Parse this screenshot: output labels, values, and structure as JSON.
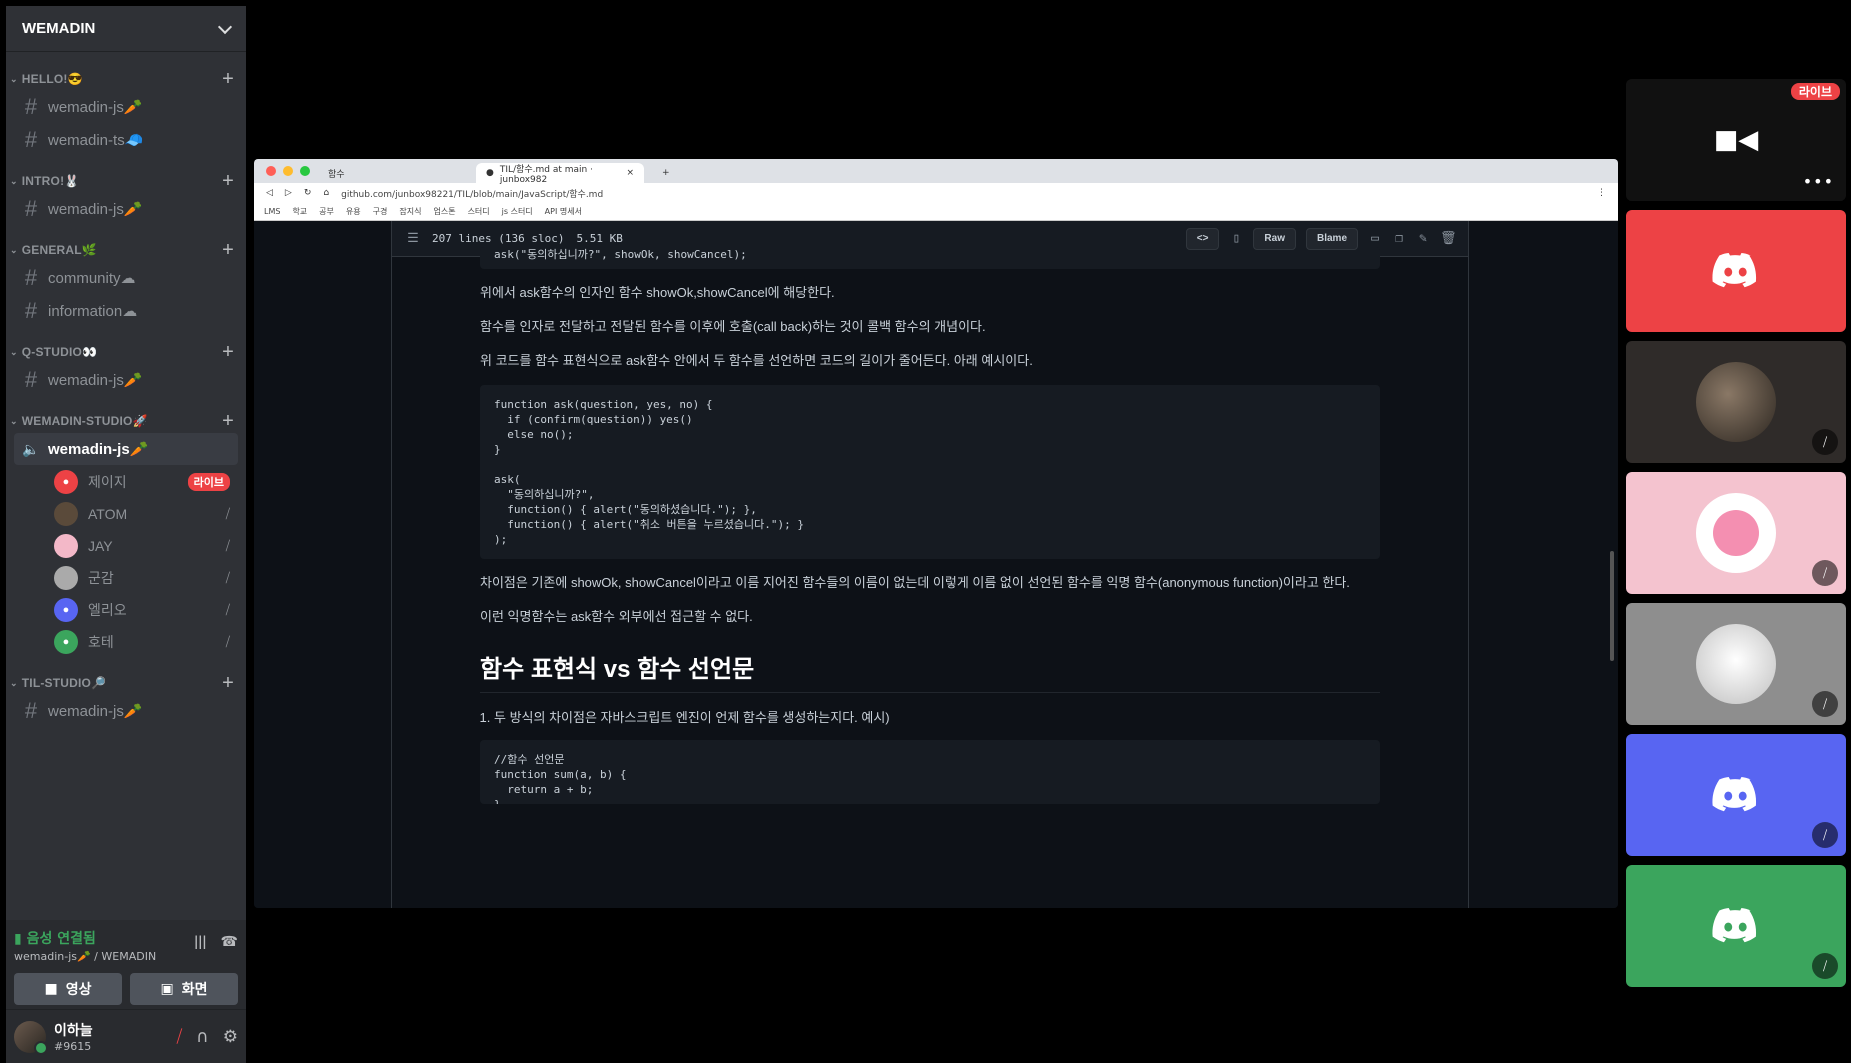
{
  "server": {
    "name": "WEMADIN"
  },
  "categories": [
    {
      "name": "HELLO!😎",
      "channels": [
        "wemadin-js🥕",
        "wemadin-ts🧢"
      ]
    },
    {
      "name": "INTRO!🐰",
      "channels": [
        "wemadin-js🥕"
      ]
    },
    {
      "name": "GENERAL🌿",
      "channels": [
        "community☁",
        "information☁"
      ]
    },
    {
      "name": "Q-STUDIO👀",
      "channels": [
        "wemadin-js🥕"
      ]
    },
    {
      "name": "WEMADIN-STUDIO🚀",
      "voice_channel": "wemadin-js🥕"
    },
    {
      "name": "TIL-STUDIO🔎",
      "channels": [
        "wemadin-js🥕"
      ]
    }
  ],
  "voice_users": [
    {
      "name": "제이지",
      "badge": "라이브",
      "color": "#ed4245"
    },
    {
      "name": "ATOM",
      "color": "#5a4a3a"
    },
    {
      "name": "JAY",
      "color": "#f3b8c8"
    },
    {
      "name": "군감",
      "color": "#aaa"
    },
    {
      "name": "엘리오",
      "color": "#5865f2"
    },
    {
      "name": "호테",
      "color": "#3ba55d"
    }
  ],
  "voice_panel": {
    "status": "음성 연결됨",
    "location": "wemadin-js🥕 / WEMADIN",
    "video_label": "영상",
    "screen_label": "화면"
  },
  "user": {
    "name": "이하늘",
    "tag": "#9615"
  },
  "browser": {
    "tab_inactive": "함수",
    "tab_active": "TIL/함수.md at main · junbox982",
    "url": "github.com/junbox98221/TIL/blob/main/JavaScript/함수.md",
    "bookmarks": [
      "LMS",
      "학교",
      "공부",
      "유용",
      "구경",
      "잡지식",
      "업스톤",
      "스터디",
      "js 스터디",
      "API 명세서"
    ]
  },
  "file_header": {
    "lines": "207 lines (136 sloc)",
    "size": "5.51 KB",
    "raw": "Raw",
    "blame": "Blame"
  },
  "doc": {
    "code_top": "ask(\"동의하십니까?\", showOk, showCancel);",
    "p1": "위에서 ask함수의 인자인 함수 showOk,showCancel에 해당한다.",
    "p2": "함수를 인자로 전달하고 전달된 함수를 이후에 호출(call back)하는 것이 콜백 함수의 개념이다.",
    "p3": "위 코드를 함수 표현식으로 ask함수 안에서 두 함수를 선언하면 코드의 길이가 줄어든다. 아래 예시이다.",
    "code1": "function ask(question, yes, no) {\n  if (confirm(question)) yes()\n  else no();\n}\n\nask(\n  \"동의하십니까?\",\n  function() { alert(\"동의하셨습니다.\"); },\n  function() { alert(\"취소 버튼을 누르셨습니다.\"); }\n);",
    "p4": "차이점은 기존에 showOk, showCancel이라고 이름 지어진 함수들의 이름이 없는데 이렇게 이름 없이 선언된 함수를 익명 함수(anonymous function)이라고 한다.",
    "p5": "이런 익명함수는 ask함수 외부에선 접근할 수 없다.",
    "h2": "함수 표현식 vs 함수 선언문",
    "li1": "두 방식의 차이점은 자바스크립트 엔진이 언제 함수를 생성하는지다. 예시)",
    "code2": "//함수 선언문\nfunction sum(a, b) {\n  return a + b;\n}"
  },
  "tiles": [
    {
      "type": "screen",
      "badge": "라이브",
      "bg": "#111111"
    },
    {
      "type": "discord",
      "bg": "#ed4245"
    },
    {
      "type": "avatar",
      "bg": "#2f2b29",
      "avatar_bg": "#5a4a3a"
    },
    {
      "type": "avatar",
      "bg": "#f4c3cf",
      "avatar_bg": "#ffffff"
    },
    {
      "type": "avatar",
      "bg": "#8e8e8e",
      "avatar_bg": "#dcdcdc"
    },
    {
      "type": "discord",
      "bg": "#5865f2"
    },
    {
      "type": "discord",
      "bg": "#3ba55d"
    }
  ]
}
